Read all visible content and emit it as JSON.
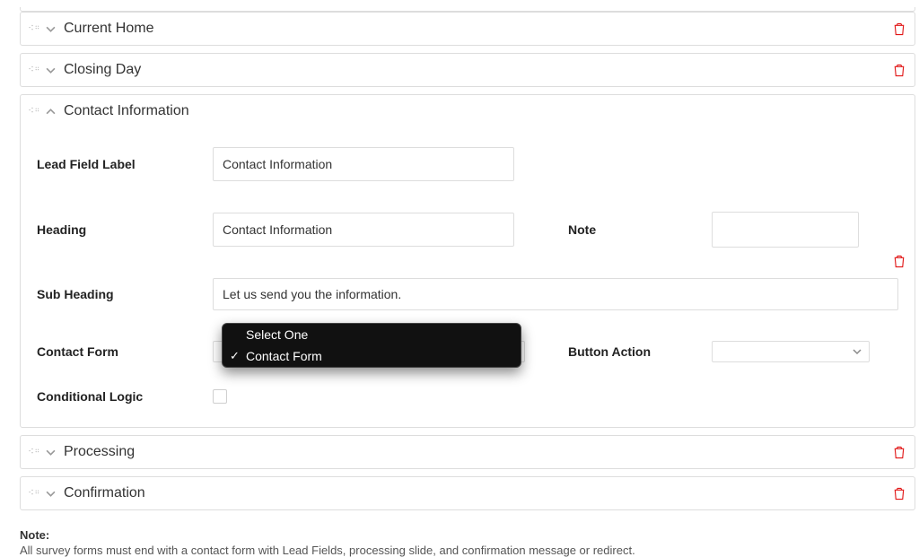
{
  "sections": {
    "s0": {
      "title": "Current Home"
    },
    "s1": {
      "title": "Closing Day"
    },
    "s2": {
      "title": "Contact Information"
    },
    "s3": {
      "title": "Processing"
    },
    "s4": {
      "title": "Confirmation"
    }
  },
  "form": {
    "lead_field_label": {
      "label": "Lead Field Label",
      "value": "Contact Information"
    },
    "heading": {
      "label": "Heading",
      "value": "Contact Information"
    },
    "note": {
      "label": "Note",
      "value": ""
    },
    "sub_heading": {
      "label": "Sub Heading",
      "value": "Let us send you the information."
    },
    "contact_form": {
      "label": "Contact Form"
    },
    "button_action": {
      "label": "Button Action"
    },
    "conditional": {
      "label": "Conditional Logic",
      "checked": false
    }
  },
  "dropdown": {
    "opt0": "Select One",
    "opt1": "Contact Form"
  },
  "footer": {
    "heading": "Note:",
    "text": "All survey forms must end with a contact form with Lead Fields, processing slide, and confirmation message or redirect."
  }
}
